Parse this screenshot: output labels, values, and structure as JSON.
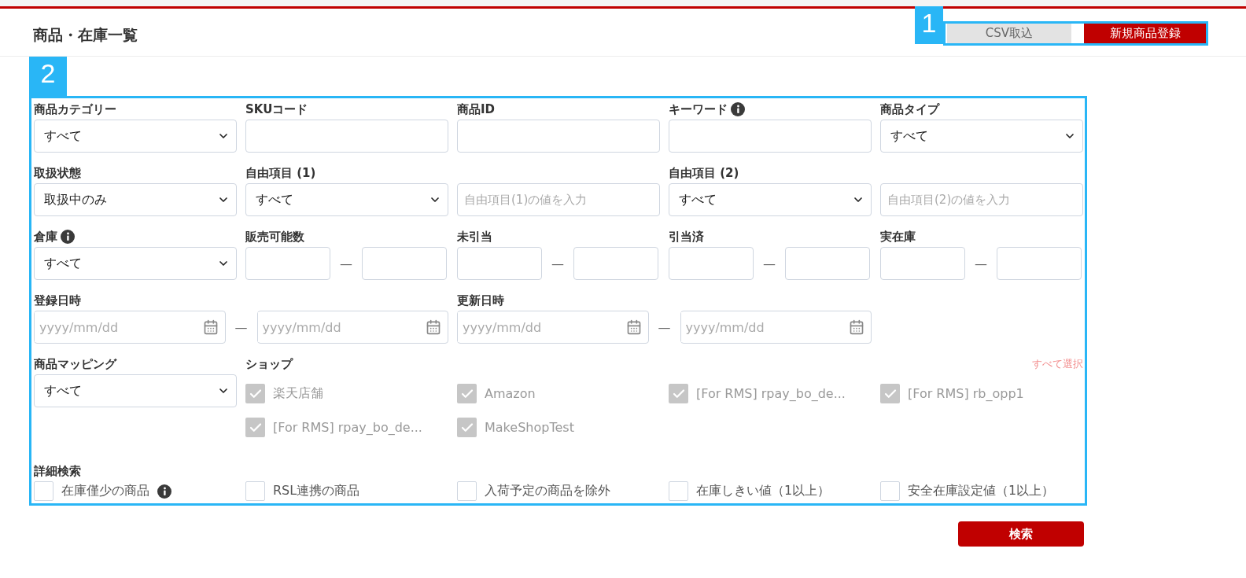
{
  "header": {
    "title": "商品・在庫一覧",
    "buttons": [
      {
        "label": "CSV取込",
        "kind": "secondary"
      },
      {
        "label": "新規商品登録",
        "kind": "primary"
      }
    ]
  },
  "callouts": [
    "1",
    "2"
  ],
  "fields": [
    {
      "kind": "select",
      "label": "商品カテゴリー",
      "value": "すべて",
      "info": false
    },
    {
      "kind": "text",
      "label": "SKUコード",
      "info": false
    },
    {
      "kind": "text",
      "label": "商品ID",
      "info": false
    },
    {
      "kind": "text",
      "label": "キーワード",
      "info": true
    },
    {
      "kind": "select",
      "label": "商品タイプ",
      "value": "すべて",
      "info": false
    },
    {
      "kind": "select",
      "label": "取扱状態",
      "value": "取扱中のみ",
      "info": false
    },
    {
      "kind": "select",
      "label": "自由項目 (1)",
      "value": "すべて",
      "info": false
    },
    {
      "kind": "text",
      "placeholder": "自由項目(1)の値を入力",
      "info": false
    },
    {
      "kind": "select",
      "label": "自由項目 (2)",
      "value": "すべて",
      "info": false
    },
    {
      "kind": "text",
      "placeholder": "自由項目(2)の値を入力",
      "info": false
    },
    {
      "kind": "select",
      "label": "倉庫",
      "value": "すべて",
      "info": true
    },
    {
      "kind": "range",
      "label": "販売可能数",
      "separator": "—",
      "info": false
    },
    {
      "kind": "range",
      "label": "未引当",
      "separator": "—",
      "info": false
    },
    {
      "kind": "range",
      "label": "引当済",
      "separator": "—",
      "info": false
    },
    {
      "kind": "range",
      "label": "実在庫",
      "separator": "—",
      "info": false
    },
    {
      "kind": "date_range",
      "label": "登録日時",
      "separator": "—",
      "from_placeholder": "yyyy/mm/dd",
      "to_placeholder": "yyyy/mm/dd",
      "info": false
    },
    {
      "kind": "date_range",
      "label": "更新日時",
      "separator": "—",
      "from_placeholder": "yyyy/mm/dd",
      "to_placeholder": "yyyy/mm/dd",
      "info": false
    }
  ],
  "mapping": {
    "label": "商品マッピング",
    "value": "すべて"
  },
  "shops": {
    "label": "ショップ",
    "select_all": "すべて選択",
    "items": [
      {
        "label": "楽天店舗",
        "checked": true,
        "disabled": true
      },
      {
        "label": "Amazon",
        "checked": true,
        "disabled": true
      },
      {
        "label": "[For RMS] rpay_bo_de...",
        "checked": true,
        "disabled": true
      },
      {
        "label": "[For RMS] rb_opp1",
        "checked": true,
        "disabled": true
      },
      {
        "label": "[For RMS] rpay_bo_de...",
        "checked": true,
        "disabled": true
      },
      {
        "label": "MakeShopTest",
        "checked": true,
        "disabled": true
      }
    ]
  },
  "detail": {
    "label": "詳細検索",
    "items": [
      {
        "label": "在庫僅少の商品",
        "checked": false,
        "info": true
      },
      {
        "label": "RSL連携の商品",
        "checked": false,
        "info": false
      },
      {
        "label": "入荷予定の商品を除外",
        "checked": false,
        "info": false
      },
      {
        "label": "在庫しきい値（1以上）",
        "checked": false,
        "info": false
      },
      {
        "label": "安全在庫設定値（1以上）",
        "checked": false,
        "info": false
      }
    ]
  },
  "search_button": "検索"
}
